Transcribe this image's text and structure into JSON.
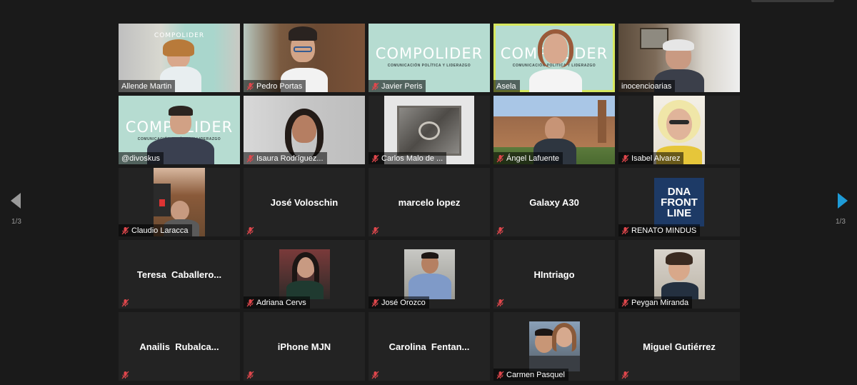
{
  "pagination": {
    "left": "1/3",
    "right": "1/3"
  },
  "brand": {
    "logo": "COMPOLIDER",
    "tagline": "COMUNICACIÓN POLÍTICA Y LIDERAZGO"
  },
  "colors": {
    "active_speaker_border": "#d7e85e",
    "next_arrow": "#1e9bd7",
    "mic_muted": "#e0474c"
  },
  "participants": [
    {
      "name": "Allende Martin",
      "muted": false
    },
    {
      "name": "Pedro Portas",
      "muted": true
    },
    {
      "name": "Javier Peris",
      "muted": true
    },
    {
      "name": "Asela",
      "muted": false,
      "active": true
    },
    {
      "name": "inocencioarias",
      "muted": false
    },
    {
      "name": "@divoskus",
      "muted": false
    },
    {
      "name": "Isaura Rodríguez...",
      "muted": true
    },
    {
      "name": "Carlos Malo de ...",
      "muted": true
    },
    {
      "name": "Ángel Lafuente",
      "muted": true
    },
    {
      "name": "Isabel Alvarez",
      "muted": true
    },
    {
      "name": "Claudio Laracca",
      "muted": true
    },
    {
      "name": "José Voloschin",
      "muted": true,
      "center": true
    },
    {
      "name": "marcelo lopez",
      "muted": true,
      "center": true
    },
    {
      "name": "Galaxy A30",
      "muted": true,
      "center": true
    },
    {
      "name": "RENATO MINDUS",
      "muted": true,
      "thumb_text": "DNA FRONT LINE"
    },
    {
      "name": "Teresa  Caballero...",
      "muted": true,
      "center": true
    },
    {
      "name": "Adriana Cervs",
      "muted": true
    },
    {
      "name": "José Orozco",
      "muted": true
    },
    {
      "name": "HIntriago",
      "muted": true,
      "center": true
    },
    {
      "name": "Peygan Miranda",
      "muted": true
    },
    {
      "name": "Anailis  Rubalca...",
      "muted": true,
      "center": true
    },
    {
      "name": "iPhone MJN",
      "muted": true,
      "center": true
    },
    {
      "name": "Carolina  Fentan...",
      "muted": true,
      "center": true
    },
    {
      "name": "Carmen Pasquel",
      "muted": true
    },
    {
      "name": "Miguel Gutiérrez",
      "muted": true,
      "center": true
    }
  ]
}
